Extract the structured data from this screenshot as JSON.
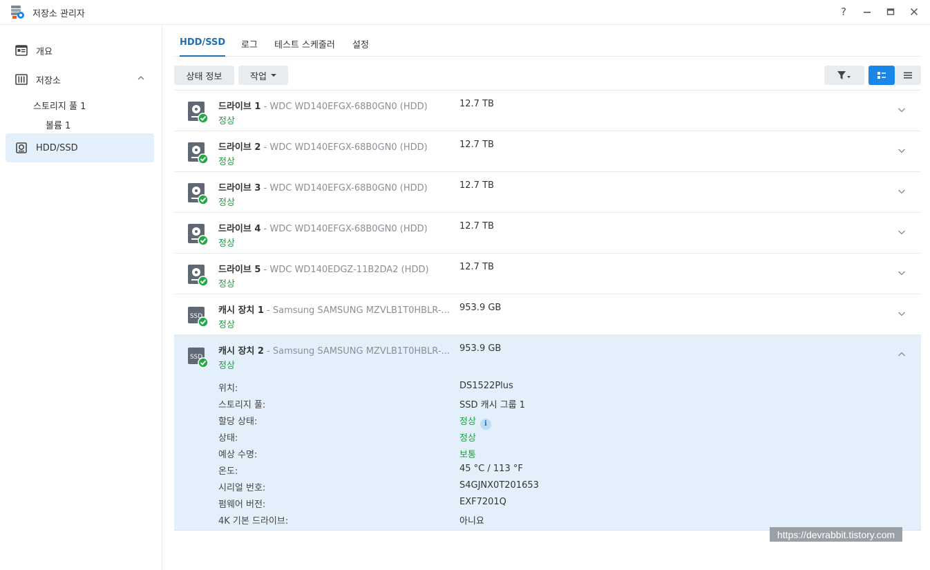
{
  "window": {
    "title": "저장소 관리자",
    "help_label": "?"
  },
  "sidebar": {
    "items": [
      {
        "label": "개요",
        "icon": "overview-icon"
      },
      {
        "label": "저장소",
        "icon": "storage-icon"
      },
      {
        "label": "HDD/SSD",
        "icon": "hdd-icon"
      }
    ],
    "sub_items": [
      {
        "label": "스토리지 풀 1"
      },
      {
        "label": "볼륨 1"
      }
    ]
  },
  "tabs": [
    {
      "label": "HDD/SSD",
      "active": true
    },
    {
      "label": "로그"
    },
    {
      "label": "테스트 스케줄러"
    },
    {
      "label": "설정"
    }
  ],
  "toolbar": {
    "status_info_label": "상태 정보",
    "action_label": "작업"
  },
  "drives": [
    {
      "name": "드라이브 1",
      "model": " - WDC WD140EFGX-68B0GN0 (HDD)",
      "status": "정상",
      "size": "12.7 TB",
      "type": "HDD"
    },
    {
      "name": "드라이브 2",
      "model": " - WDC WD140EFGX-68B0GN0 (HDD)",
      "status": "정상",
      "size": "12.7 TB",
      "type": "HDD"
    },
    {
      "name": "드라이브 3",
      "model": " - WDC WD140EFGX-68B0GN0 (HDD)",
      "status": "정상",
      "size": "12.7 TB",
      "type": "HDD"
    },
    {
      "name": "드라이브 4",
      "model": " - WDC WD140EFGX-68B0GN0 (HDD)",
      "status": "정상",
      "size": "12.7 TB",
      "type": "HDD"
    },
    {
      "name": "드라이브 5",
      "model": " - WDC WD140EDGZ-11B2DA2 (HDD)",
      "status": "정상",
      "size": "12.7 TB",
      "type": "HDD"
    },
    {
      "name": "캐시 장치 1",
      "model": " - Samsung SAMSUNG MZVLB1T0HBLR-...",
      "status": "정상",
      "size": "953.9 GB",
      "type": "SSD"
    },
    {
      "name": "캐시 장치 2",
      "model": " - Samsung SAMSUNG MZVLB1T0HBLR-...",
      "status": "정상",
      "size": "953.9 GB",
      "type": "SSD"
    }
  ],
  "ssd_label": "SSD",
  "details": [
    {
      "label": "위치:",
      "value": "DS1522Plus"
    },
    {
      "label": "스토리지 풀:",
      "value": "SSD 캐시 그룹 1"
    },
    {
      "label": "할당 상태:",
      "value": "정상"
    },
    {
      "label": "상태:",
      "value": "정상"
    },
    {
      "label": "예상 수명:",
      "value": "보통"
    },
    {
      "label": "온도:",
      "value": "45 °C / 113 °F"
    },
    {
      "label": "시리얼 번호:",
      "value": "S4GJNX0T201653"
    },
    {
      "label": "펌웨어 버전:",
      "value": "EXF7201Q"
    },
    {
      "label": "4K 기본 드라이브:",
      "value": "아니요"
    }
  ],
  "info_glyph": "i",
  "watermark": "https://devrabbit.tistory.com",
  "colors": {
    "accent": "#1a86e8",
    "ok": "#1e9e3e",
    "selected_bg": "#e3f0fc"
  }
}
